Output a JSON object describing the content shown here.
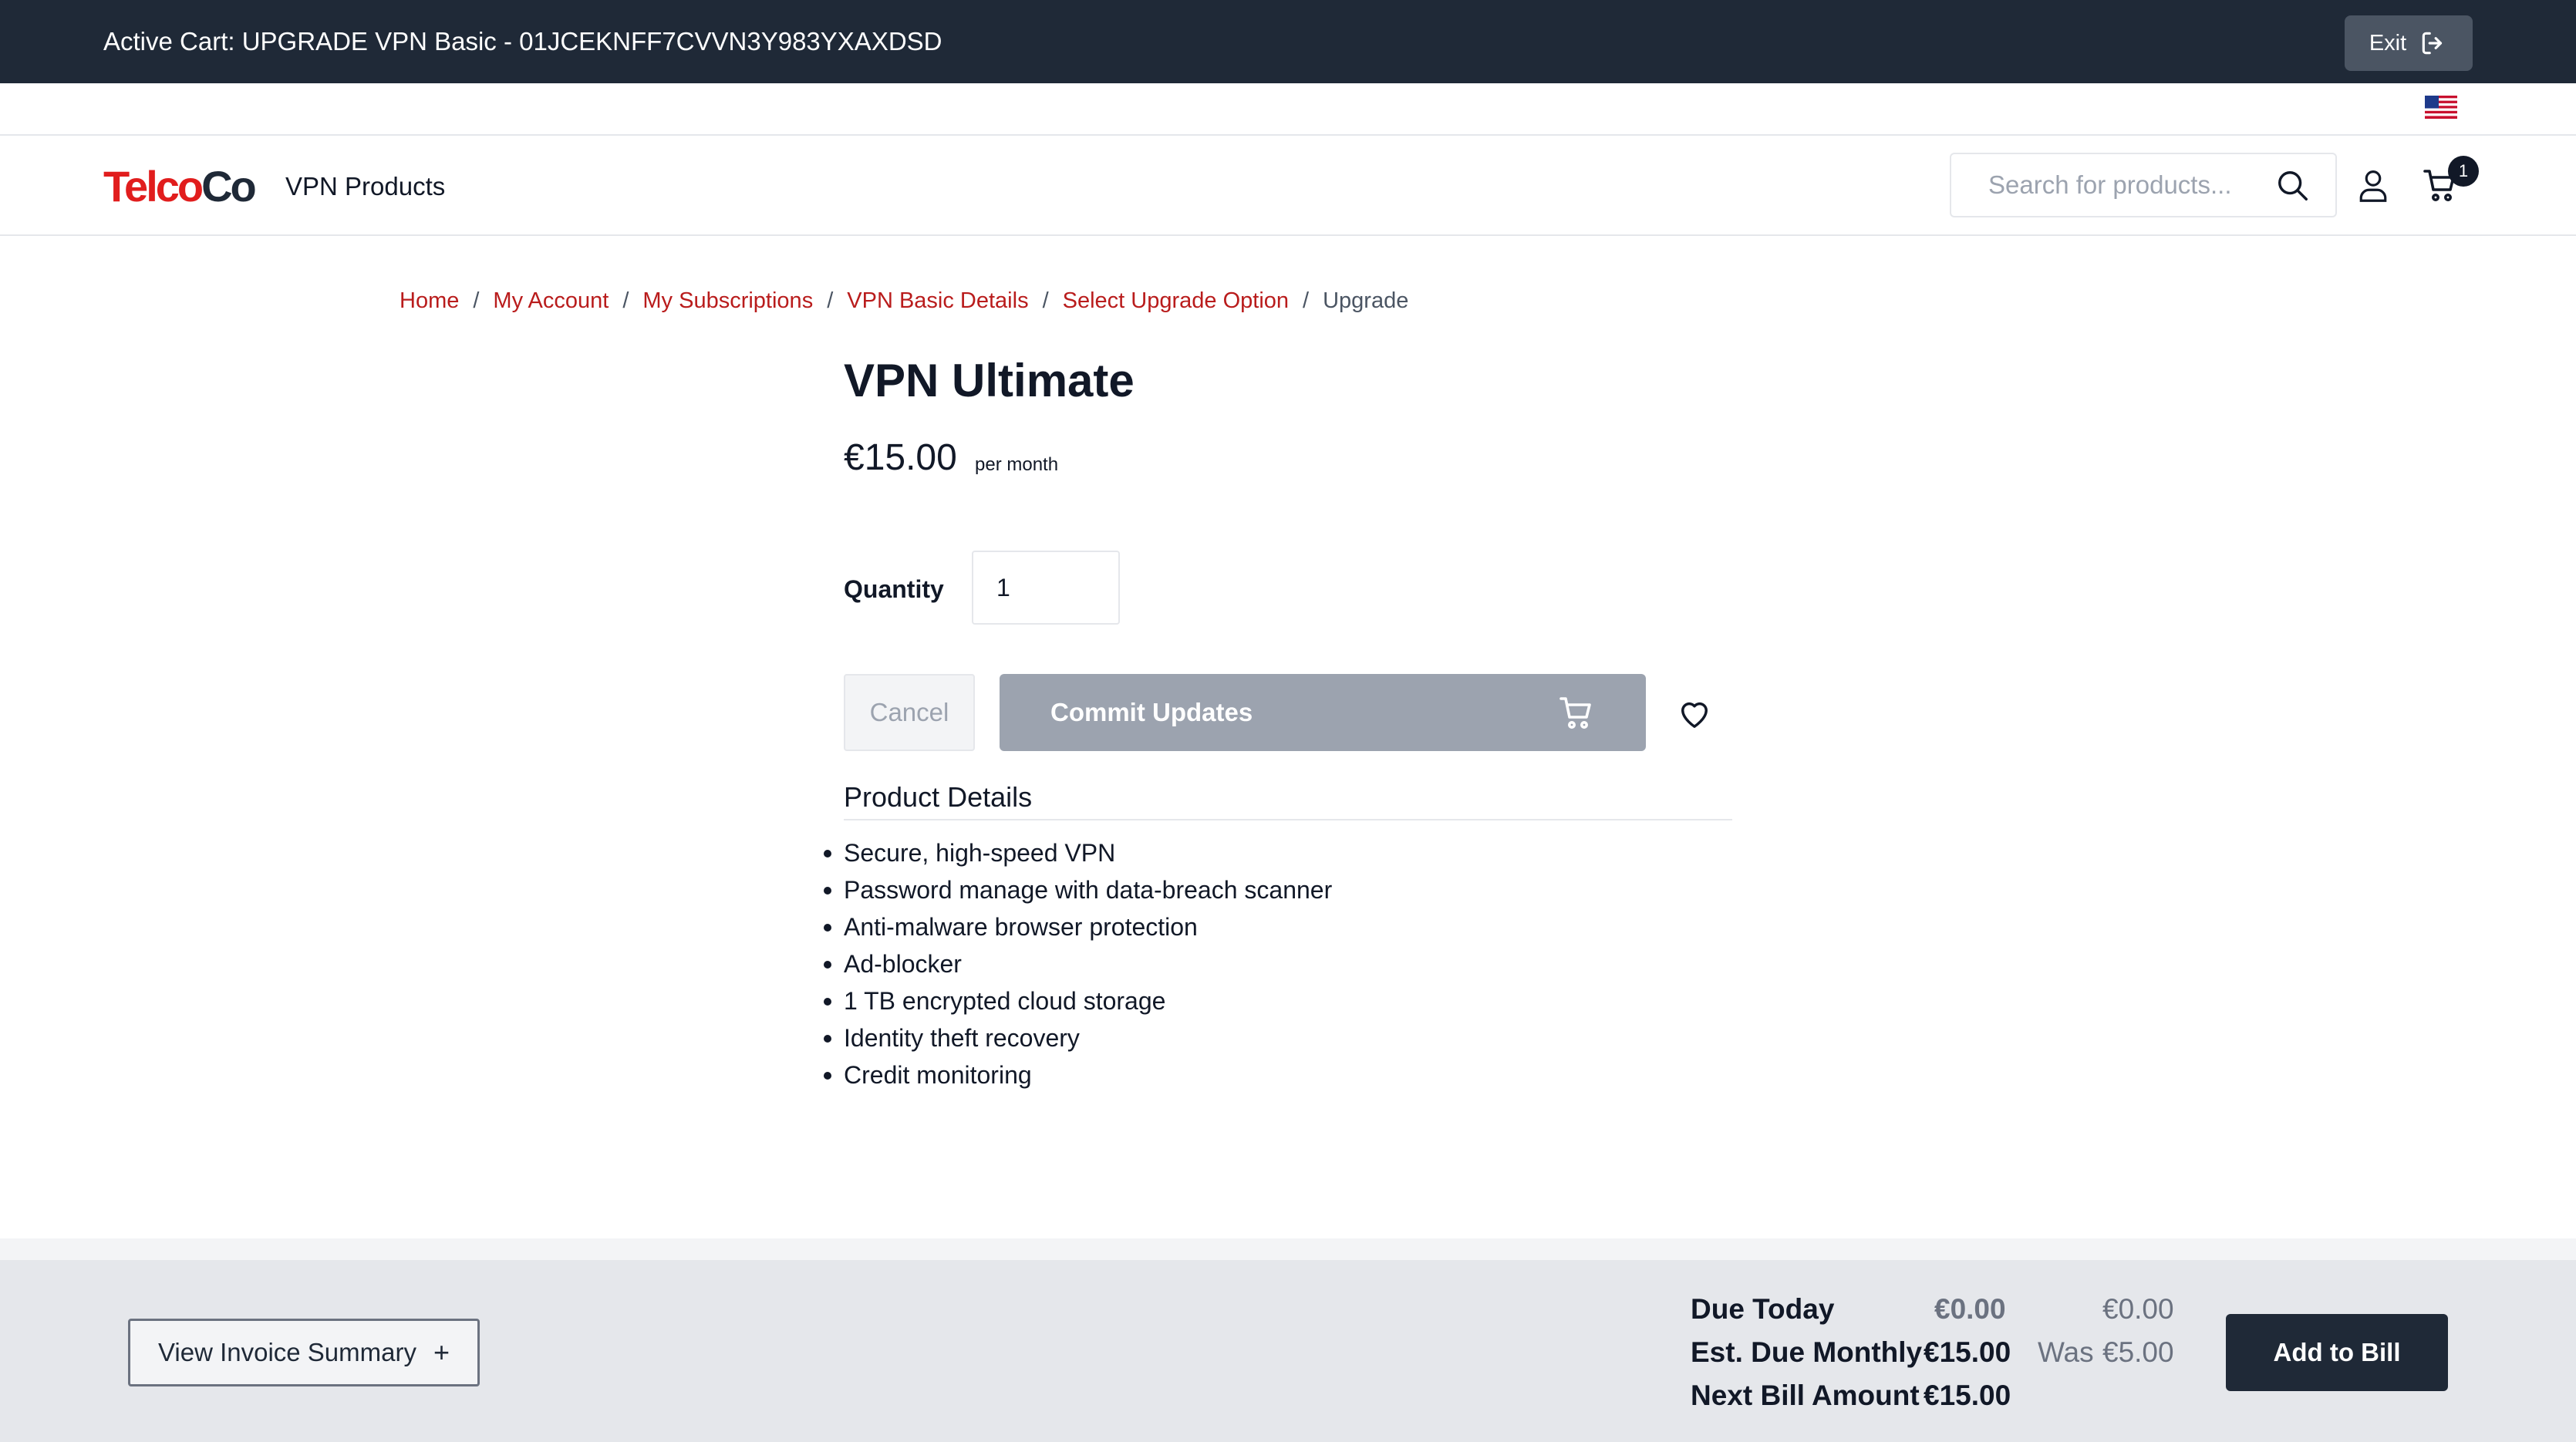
{
  "topbar": {
    "cart_text": "Active Cart: UPGRADE VPN Basic - 01JCEKNFF7CVVN3Y983YXAXDSD",
    "exit_label": "Exit"
  },
  "header": {
    "logo_part1": "Telco",
    "logo_part2": "Co",
    "nav_link": "VPN Products",
    "search_placeholder": "Search for products...",
    "cart_count": "1"
  },
  "breadcrumb": {
    "items": [
      "Home",
      "My Account",
      "My Subscriptions",
      "VPN Basic Details",
      "Select Upgrade Option"
    ],
    "current": "Upgrade",
    "separator": "/"
  },
  "product": {
    "title": "VPN Ultimate",
    "price": "€15.00",
    "price_unit": "per month",
    "quantity_label": "Quantity",
    "quantity_value": "1",
    "cancel_label": "Cancel",
    "commit_label": "Commit Updates",
    "details_heading": "Product Details",
    "features": [
      "Secure, high-speed VPN",
      "Password manage with data-breach scanner",
      "Anti-malware browser protection",
      "Ad-blocker",
      "1 TB encrypted cloud storage",
      "Identity theft recovery",
      "Credit monitoring"
    ]
  },
  "footer": {
    "invoice_label": "View Invoice Summary",
    "invoice_plus": "+",
    "due_today_label": "Due Today",
    "due_today_value": "€0.00",
    "due_today_previous": "€0.00",
    "est_monthly_label": "Est. Due Monthly",
    "est_monthly_value": "€15.00",
    "was_label": "Was",
    "est_monthly_previous": "€5.00",
    "next_bill_label": "Next Bill Amount",
    "next_bill_value": "€15.00",
    "add_to_bill_label": "Add to Bill"
  },
  "colors": {
    "topbar_bg": "#1f2937",
    "brand_red": "#e11d1d",
    "link_red": "#b91c1c",
    "disabled_button": "#9ca3af",
    "primary_button": "#1f2937"
  },
  "icons": [
    "sign-out-icon",
    "us-flag-icon",
    "search-icon",
    "user-icon",
    "cart-icon",
    "heart-icon"
  ]
}
